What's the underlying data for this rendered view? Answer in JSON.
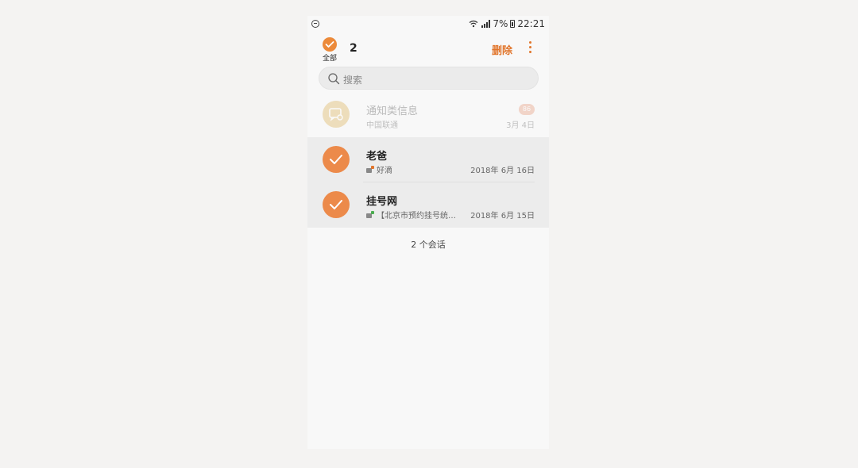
{
  "status_bar": {
    "battery": "7%",
    "time": "22:21"
  },
  "header": {
    "select_all_label": "全部",
    "selected_count": "2",
    "delete_label": "删除"
  },
  "search": {
    "placeholder": "搜索"
  },
  "conversations": [
    {
      "name": "通知类信息",
      "preview": "中国联通",
      "date": "3月 4日",
      "badge": "86",
      "selected": false
    },
    {
      "name": "老爸",
      "preview": "好滴",
      "date": "2018年 6月 16日",
      "selected": true
    },
    {
      "name": "挂号网",
      "preview": "【北京市预约挂号统…",
      "date": "2018年 6月 15日",
      "selected": true
    }
  ],
  "footer": {
    "conversation_count": "2 个会话"
  },
  "colors": {
    "accent": "#ec8a3a",
    "delete": "#e1752b",
    "notify_avatar": "#dcb25a"
  }
}
